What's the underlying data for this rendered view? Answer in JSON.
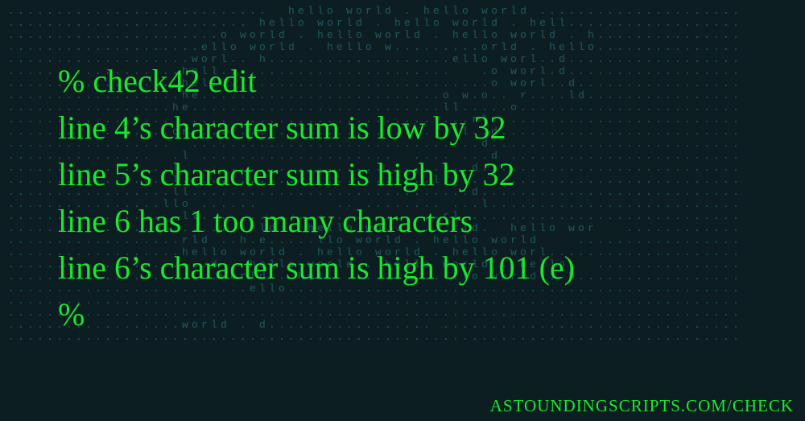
{
  "terminal": {
    "prompt": "%",
    "command": "check42 edit",
    "output": [
      "line 4’s character sum is low by 32",
      "line 5’s character sum is high by 32",
      "line 6 has 1 too many characters",
      "line 6’s character sum is high by 101 (e)"
    ],
    "prompt_after": "%"
  },
  "watermark": "ASTOUNDINGSCRIPTS.COM/CHECK",
  "ascii_art": [
    "...........................  hello world . hello world .....................",
    "......................... hello world . hello world . hell..................",
    "......................o world . hello world . hello world . h...............",
    "....................ello world . hello w.........orld . hello...............",
    "...................worl.. h...................ello worl..d..................",
    "..................hell........................   .o worl.d..................",
    "..................hell............................o worl..d.................",
    "..................he.........................o w.o.. r....ld................",
    ".................he..........................ll.....o.......................",
    ".................  ....  .......................rl..........................",
    ".................or............................l..d.........................",
    ".................  ..............................d..........................",
    "...............  .l ....................  .... ...d ........................",
    ".................l..............................d...........................",
    ".................l..........................l...............................",
    ".................ll.............................d...........................",
    "................llo ......        .. ........ ...l..........................",
    "..................ll.........................rl.............................",
    ".........................rld . hello wo.......rld.  hello wor   ............",
    "..................rld ..h.e.....llo world . hello world    .................",
    "..................hello world . hello world . hello worl....................",
    ".....................d . hello world . hello world . hello   ...............",
    "......................world . hel..............lo world . h.................",
    ".........................ello...............................................",
    "............................................................................",
    "............................................................................",
    "..................world . d................. ...............................",
    "............................................................................"
  ]
}
